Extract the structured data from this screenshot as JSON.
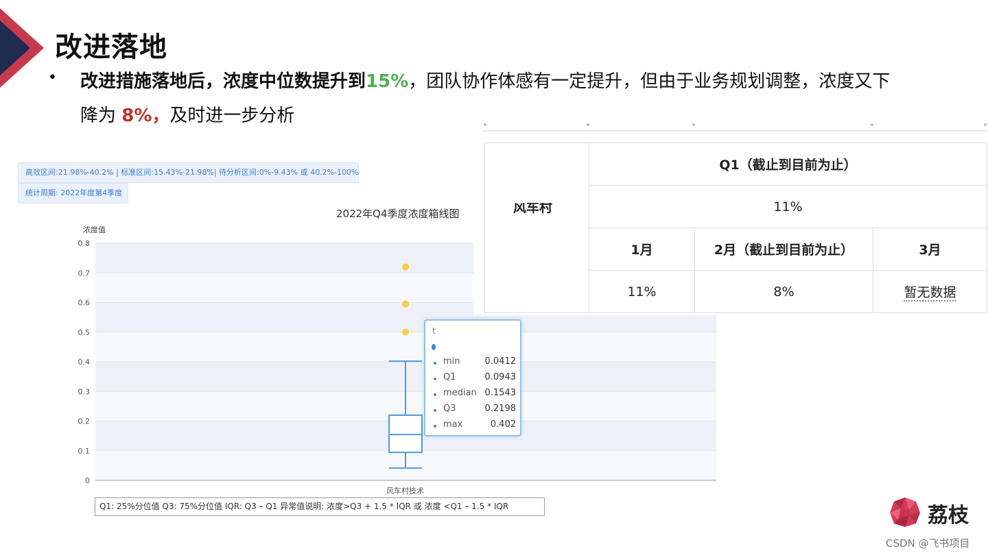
{
  "slide": {
    "title": "改进落地",
    "bullet": {
      "part1": "改进措施落地后，浓度中位数提升到",
      "highlight1": "15%",
      "part2": "，团队协作体感有一定提升，但由于业务规划调整，浓度又下",
      "part3": "降为 ",
      "highlight2": "8%，",
      "part4": "及时进一步分析"
    }
  },
  "chart_notes": {
    "range_note": "高效区间:21.98%-40.2% | 标准区间:15.43%-21.98%| 待分析区间:0%-9.43% 或 40.2%-100%",
    "period_note": "统计周期: 2022年度第4季度"
  },
  "chart_data": {
    "type": "boxplot",
    "title": "2022年Q4季度浓度箱线图",
    "ylabel": "浓度值",
    "xlabel": "",
    "categories": [
      "风车村技术"
    ],
    "ylim": [
      0,
      0.8
    ],
    "yticks": [
      "0",
      "0.1",
      "0.2",
      "0.3",
      "0.4",
      "0.5",
      "0.6",
      "0.7",
      "0.8"
    ],
    "box": {
      "min": 0.0412,
      "q1": 0.0943,
      "median": 0.1543,
      "q3": 0.2198,
      "max": 0.402
    },
    "outliers": [
      0.72,
      0.595,
      0.5
    ],
    "grid": true,
    "footnote": "Q1: 25%分位值  Q3: 75%分位值  IQR: Q3 – Q1  异常值说明: 浓度>Q3 + 1.5 * IQR 或 浓度 <Q1 – 1.5 * IQR"
  },
  "tooltip": {
    "header": "t",
    "rows": [
      {
        "k": "min",
        "v": "0.0412"
      },
      {
        "k": "Q1",
        "v": "0.0943"
      },
      {
        "k": "median",
        "v": "0.1543"
      },
      {
        "k": "Q3",
        "v": "0.2198"
      },
      {
        "k": "max",
        "v": "0.402"
      }
    ]
  },
  "table": {
    "row_header": "风车村",
    "q1_header": "Q1（截止到目前为止）",
    "q1_value": "11%",
    "months": [
      "1月",
      "2月（截止到目前为止）",
      "3月"
    ],
    "month_values": [
      "11%",
      "8%",
      "暂无数据"
    ]
  },
  "brand": {
    "name": "荔枝"
  },
  "watermark": "CSDN @飞书项目",
  "colors": {
    "accent_red": "#c0322c",
    "accent_green": "#4caf50",
    "box_blue": "#4d9bd6",
    "outlier_yellow": "#f7ce46"
  }
}
